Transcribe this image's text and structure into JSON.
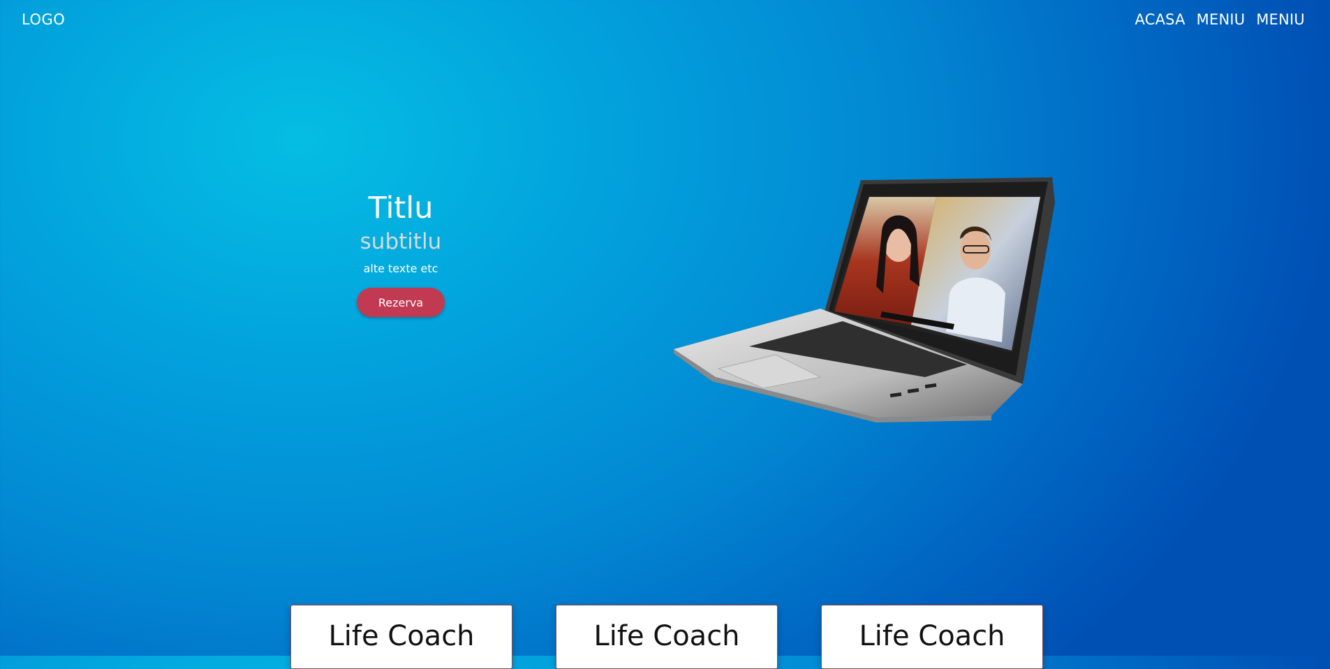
{
  "header": {
    "logo": "LOGO",
    "nav": [
      "ACASA",
      "MENIU",
      "MENIU"
    ]
  },
  "hero": {
    "title": "Titlu",
    "subtitle": "subtitlu",
    "text": "alte texte etc",
    "button_label": "Rezerva"
  },
  "cards": [
    {
      "title": "Life Coach"
    },
    {
      "title": "Life Coach"
    },
    {
      "title": "Life Coach"
    }
  ],
  "colors": {
    "button": "#c13a52",
    "background_light": "#05bde3",
    "background_dark": "#004fb3"
  }
}
